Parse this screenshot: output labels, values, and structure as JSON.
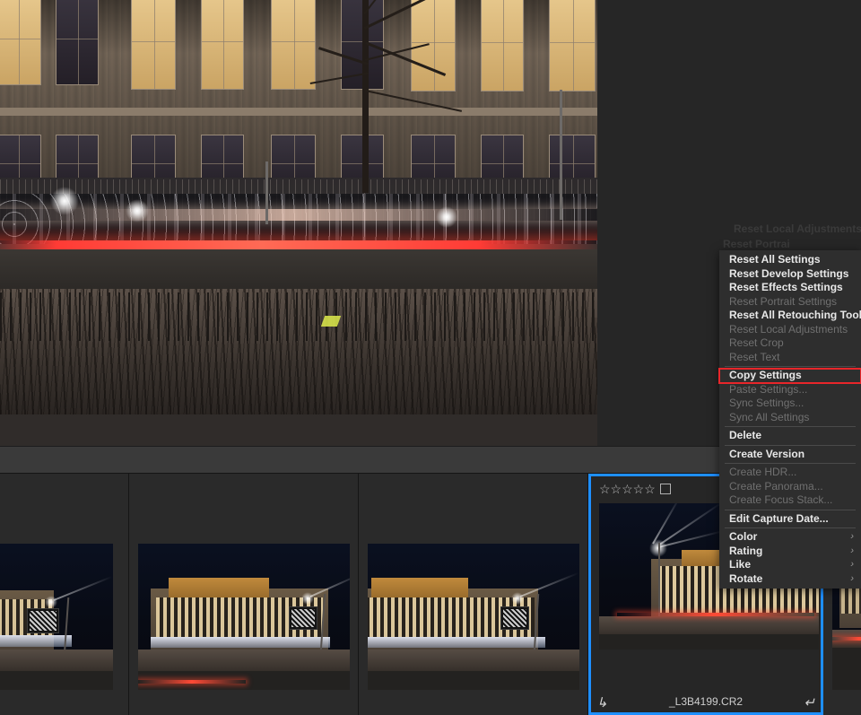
{
  "app": {
    "name": "photo-editor",
    "accent_blue": "#1e8fff",
    "highlight_red": "#e8262a",
    "menu_bg": "#2e2e2e",
    "panel_bg": "#2a2a2a",
    "toolbar_bg": "#3a3a3a"
  },
  "viewer": {
    "image_alt": "Night photo of a brick office building facade with lit windows, bare trees, parked bicycles and red light trails along the street"
  },
  "context_menu": {
    "ghost_fragments": [
      "Reset Local Adjustments",
      "Reset Portrai"
    ],
    "items": [
      {
        "label": "Reset All Settings",
        "enabled": true,
        "submenu": false,
        "highlighted": false,
        "separator_after": false
      },
      {
        "label": "Reset Develop Settings",
        "enabled": true,
        "submenu": false,
        "highlighted": false,
        "separator_after": false
      },
      {
        "label": "Reset Effects Settings",
        "enabled": true,
        "submenu": false,
        "highlighted": false,
        "separator_after": false
      },
      {
        "label": "Reset Portrait Settings",
        "enabled": false,
        "submenu": false,
        "highlighted": false,
        "separator_after": false
      },
      {
        "label": "Reset All Retouching Tools",
        "enabled": true,
        "submenu": false,
        "highlighted": false,
        "separator_after": false
      },
      {
        "label": "Reset Local Adjustments",
        "enabled": false,
        "submenu": false,
        "highlighted": false,
        "separator_after": false
      },
      {
        "label": "Reset Crop",
        "enabled": false,
        "submenu": false,
        "highlighted": false,
        "separator_after": false
      },
      {
        "label": "Reset Text",
        "enabled": false,
        "submenu": false,
        "highlighted": false,
        "separator_after": true
      },
      {
        "label": "Copy Settings",
        "enabled": true,
        "submenu": false,
        "highlighted": true,
        "separator_after": false
      },
      {
        "label": "Paste Settings...",
        "enabled": false,
        "submenu": false,
        "highlighted": false,
        "separator_after": false
      },
      {
        "label": "Sync Settings...",
        "enabled": false,
        "submenu": false,
        "highlighted": false,
        "separator_after": false
      },
      {
        "label": "Sync All Settings",
        "enabled": false,
        "submenu": false,
        "highlighted": false,
        "separator_after": true
      },
      {
        "label": "Delete",
        "enabled": true,
        "submenu": false,
        "highlighted": false,
        "separator_after": true
      },
      {
        "label": "Create Version",
        "enabled": true,
        "submenu": false,
        "highlighted": false,
        "separator_after": true
      },
      {
        "label": "Create HDR...",
        "enabled": false,
        "submenu": false,
        "highlighted": false,
        "separator_after": false
      },
      {
        "label": "Create Panorama...",
        "enabled": false,
        "submenu": false,
        "highlighted": false,
        "separator_after": false
      },
      {
        "label": "Create Focus Stack...",
        "enabled": false,
        "submenu": false,
        "highlighted": false,
        "separator_after": true
      },
      {
        "label": "Edit Capture Date...",
        "enabled": true,
        "submenu": false,
        "highlighted": false,
        "separator_after": true
      },
      {
        "label": "Color",
        "enabled": true,
        "submenu": true,
        "highlighted": false,
        "separator_after": false
      },
      {
        "label": "Rating",
        "enabled": true,
        "submenu": true,
        "highlighted": false,
        "separator_after": false
      },
      {
        "label": "Like",
        "enabled": true,
        "submenu": true,
        "highlighted": false,
        "separator_after": false
      },
      {
        "label": "Rotate",
        "enabled": true,
        "submenu": true,
        "highlighted": false,
        "separator_after": false
      }
    ],
    "submenu_chevron": "›"
  },
  "filmstrip": {
    "selected_filename": "_L3B4199.CR2",
    "rating_stars": "☆☆☆☆☆",
    "rating_star_count": 5,
    "rating_value": 0,
    "color_label": "none",
    "rotate_left_icon": "↵",
    "rotate_right_icon": "↳",
    "thumbnails": [
      {
        "id": "thumb-1",
        "selected": false,
        "partial": true,
        "filename": ""
      },
      {
        "id": "thumb-2",
        "selected": false,
        "partial": false,
        "filename": ""
      },
      {
        "id": "thumb-3",
        "selected": false,
        "partial": false,
        "filename": ""
      },
      {
        "id": "thumb-4",
        "selected": true,
        "partial": false,
        "filename": "_L3B4199.CR2"
      },
      {
        "id": "thumb-5",
        "selected": false,
        "partial": true,
        "filename": ""
      }
    ]
  }
}
